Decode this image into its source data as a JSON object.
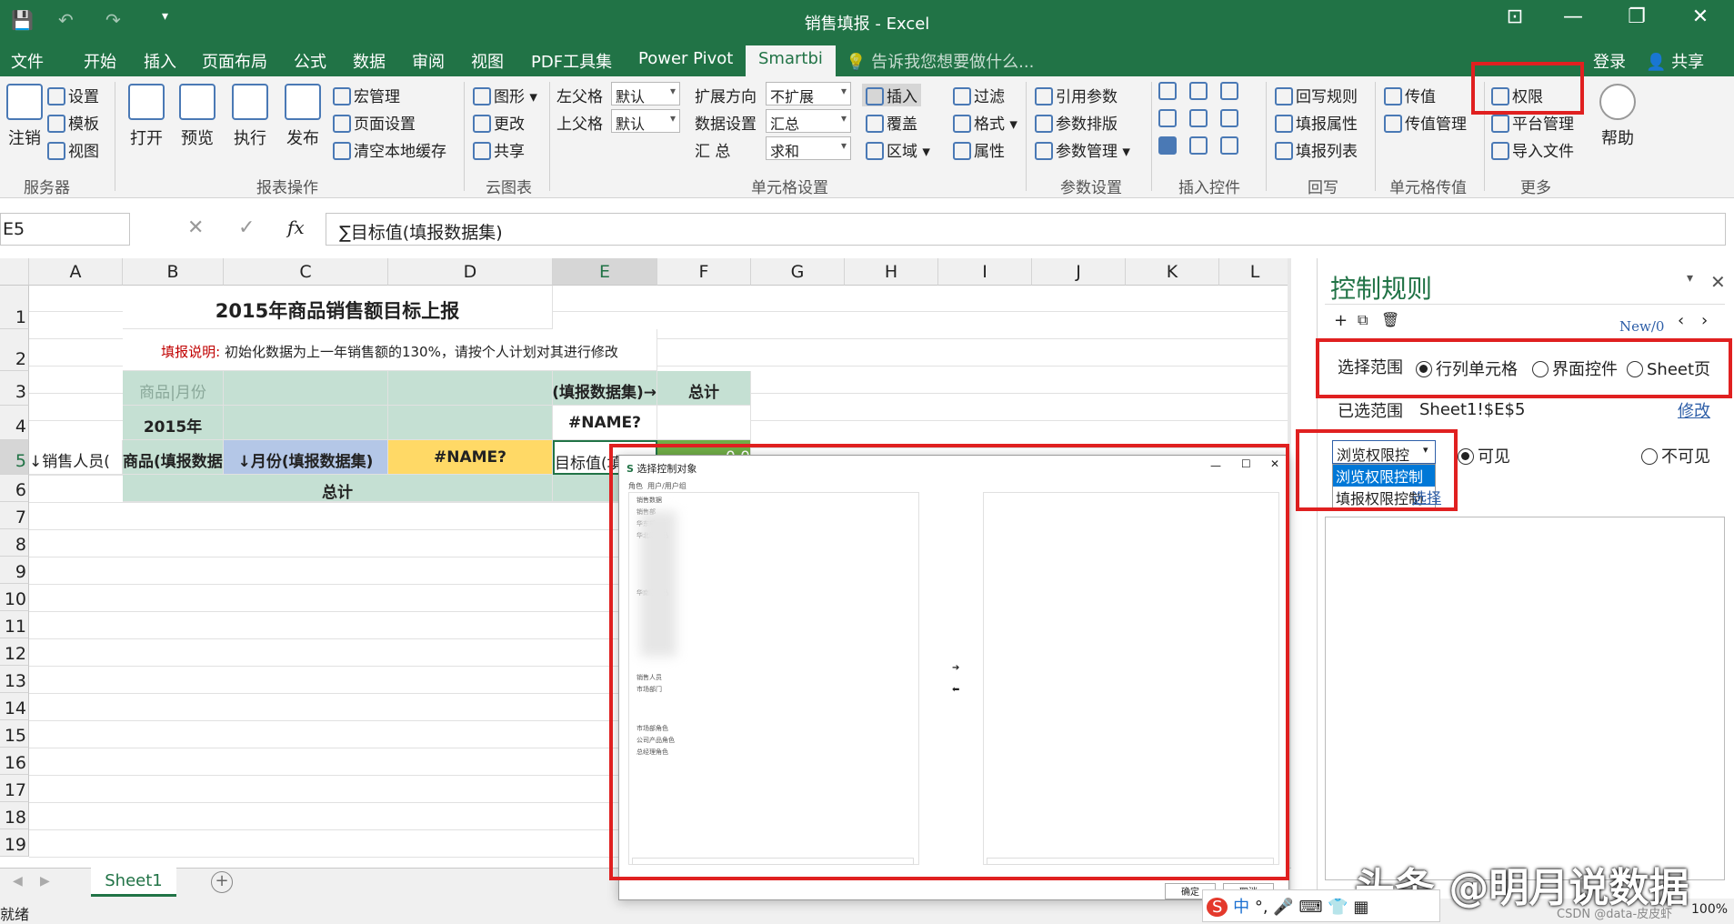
{
  "window": {
    "title": "销售填报 - Excel",
    "min": "—",
    "restore": "❐",
    "close": "✕",
    "ribbon_display": "⊡"
  },
  "quick": {
    "save": "💾",
    "undo": "↶",
    "redo": "↷",
    "more": "▾"
  },
  "menu": {
    "tabs": [
      "文件",
      "开始",
      "插入",
      "页面布局",
      "公式",
      "数据",
      "审阅",
      "视图",
      "PDF工具集",
      "Power Pivot",
      "Smartbi"
    ],
    "tell_me": "告诉我您想要做什么...",
    "login": "登录",
    "share": "共享"
  },
  "ribbon": {
    "server": {
      "logout": "注销",
      "settings": "设置",
      "template": "模板",
      "view": "视图",
      "label": "服务器"
    },
    "report": {
      "open": "打开",
      "preview": "预览",
      "execute": "执行",
      "publish": "发布",
      "macro": "宏管理",
      "page_setup": "页面设置",
      "clear_cache": "清空本地缓存",
      "label": "报表操作"
    },
    "cloud": {
      "chart": "图形",
      "change": "更改",
      "share": "共享",
      "label": "云图表"
    },
    "cellset": {
      "left_parent": "左父格",
      "left_parent_val": "默认",
      "top_parent": "上父格",
      "top_parent_val": "默认",
      "expand_dir": "扩展方向",
      "expand_val": "不扩展",
      "data_set": "数据设置",
      "data_val": "汇总",
      "summary": "汇    总",
      "summary_val": "求和",
      "insert": "插入",
      "cover": "覆盖",
      "area": "区域",
      "filter": "过滤",
      "format": "格式",
      "attr": "属性",
      "label": "单元格设置"
    },
    "params": {
      "ref": "引用参数",
      "layout": "参数排版",
      "manage": "参数管理",
      "label": "参数设置"
    },
    "controls": {
      "label": "插入控件"
    },
    "writeback": {
      "rules": "回写规则",
      "attrs": "填报属性",
      "list": "填报列表",
      "label": "回写"
    },
    "passval": {
      "pass": "传值",
      "manage": "传值管理",
      "label": "单元格传值"
    },
    "more": {
      "perm": "权限",
      "platform": "平台管理",
      "import": "导入文件",
      "help": "帮助",
      "label": "更多"
    }
  },
  "formula": {
    "name_box": "E5",
    "cancel": "✕",
    "enter": "✓",
    "fx": "fx",
    "content": "∑目标值(填报数据集)"
  },
  "grid": {
    "columns": [
      "A",
      "B",
      "C",
      "D",
      "E",
      "F",
      "G",
      "H",
      "I",
      "J",
      "K",
      "L"
    ],
    "rows": [
      "1",
      "2",
      "3",
      "4",
      "5",
      "6",
      "7",
      "8",
      "9",
      "10",
      "11",
      "12",
      "13",
      "14",
      "15",
      "16",
      "17",
      "18",
      "19"
    ],
    "title": "2015年商品销售额目标上报",
    "note_label": "填报说明:",
    "note_text": "初始化数据为上一年销售额的130%，请按个人计划对其进行修改",
    "b3": "商品|月份",
    "e3": "→月份(填报数据集)",
    "f3": "总计",
    "b4": "2015年",
    "e4": "#NAME?",
    "a5": "↓销售人员(",
    "b5": "商品(填报数据集)",
    "c5": "↓月份(填报数据集)",
    "d5": "#NAME?",
    "e5": "目标值(填报数据集)",
    "f5": "0.0",
    "c6": "总计"
  },
  "sheets": {
    "tab": "Sheet1",
    "add": "+"
  },
  "status": {
    "ready": "就绪",
    "zoom": "100%",
    "watermark": "CSDN @data-皮皮虾"
  },
  "overlay": {
    "watermark": "头条 @明月说数据"
  },
  "panel": {
    "title": "控制规则",
    "pager": "New/0",
    "scope_label": "选择范围",
    "scope_opts": [
      "行列单元格",
      "界面控件",
      "Sheet页"
    ],
    "selected_label": "已选范围",
    "selected_value": "Sheet1!$E$5",
    "edit": "修改",
    "mode_value": "浏览权限控",
    "mode_options": [
      "浏览权限控制",
      "填报权限控制"
    ],
    "visible": "可见",
    "invisible": "不可见",
    "link": "选择"
  },
  "dialog": {
    "title": "选择控制对象",
    "tabs": [
      "角色",
      "用户/用户组"
    ],
    "items": [
      "销售数据",
      "销售部",
      "华东部",
      "华北区商品",
      "华南区商品",
      "销售人员",
      "市场部门",
      "市场部角色",
      "公司产品角色",
      "总经理角色"
    ],
    "arrow_right": "➔",
    "arrow_left": "⬅",
    "ok": "确定",
    "cancel": "取消"
  },
  "ime": {
    "items": [
      "中",
      "°,",
      "🎤",
      "⌨",
      "👕",
      "▦"
    ]
  },
  "colors": {
    "excel_green": "#217346",
    "header_green": "#c5e0d3",
    "blue_cell": "#b4c7e7",
    "yellow_cell": "#ffd966",
    "red_box": "#e02020"
  }
}
